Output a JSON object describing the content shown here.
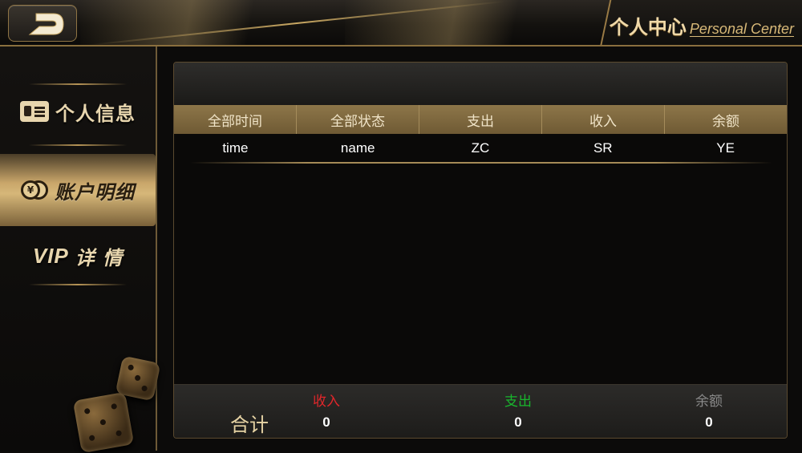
{
  "header": {
    "back_icon": "back-arrow-icon",
    "title_cn": "个人中心",
    "title_en": "Personal Center"
  },
  "sidebar": {
    "items": [
      {
        "label": "个人信息",
        "icon": "id-card-icon",
        "active": false
      },
      {
        "label": "账户明细",
        "icon": "coins-icon",
        "coin_glyph": "¥",
        "active": true
      },
      {
        "label_prefix": "VIP",
        "label": "详 情",
        "active": false
      }
    ],
    "decoration": "dice-icon"
  },
  "table": {
    "headers": [
      "全部时间",
      "全部状态",
      "支出",
      "收入",
      "余额"
    ],
    "rows": [
      [
        "time",
        "name",
        "ZC",
        "SR",
        "YE"
      ]
    ]
  },
  "footer": {
    "total_label": "合计",
    "income": {
      "label": "收入",
      "value": "0",
      "color": "#e0262a"
    },
    "expense": {
      "label": "支出",
      "value": "0",
      "color": "#19b52d"
    },
    "balance": {
      "label": "余额",
      "value": "0",
      "color": "#8a8a8a"
    }
  },
  "colors": {
    "gold": "#c9a863",
    "header_bg": "#8d7649",
    "panel_bg": "#0a0908"
  }
}
